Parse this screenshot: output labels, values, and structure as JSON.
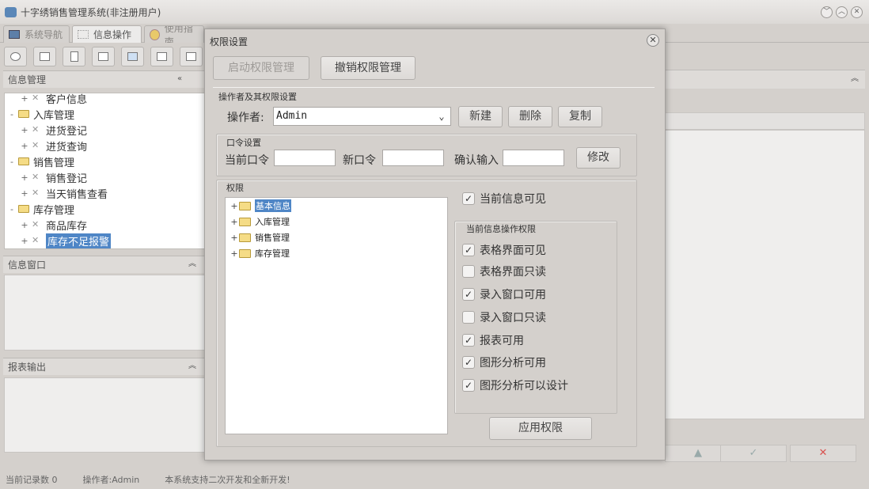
{
  "app": {
    "title": "十字绣销售管理系统(非注册用户)",
    "window_buttons": [
      "﹀",
      "︿",
      "✕"
    ]
  },
  "tabs": [
    {
      "label": "系统导航"
    },
    {
      "label": "信息操作"
    },
    {
      "label": "使用指南"
    }
  ],
  "left": {
    "info_mgmt": {
      "title": "信息管理",
      "collapse": "«"
    },
    "tree": [
      {
        "label": "客户信息",
        "level": 1,
        "exp": "+"
      },
      {
        "label": "入库管理",
        "level": 0,
        "exp": "-"
      },
      {
        "label": "进货登记",
        "level": 1,
        "exp": "+"
      },
      {
        "label": "进货查询",
        "level": 1,
        "exp": "+"
      },
      {
        "label": "销售管理",
        "level": 0,
        "exp": "-"
      },
      {
        "label": "销售登记",
        "level": 1,
        "exp": "+"
      },
      {
        "label": "当天销售查看",
        "level": 1,
        "exp": "+"
      },
      {
        "label": "库存管理",
        "level": 0,
        "exp": "-"
      },
      {
        "label": "商品库存",
        "level": 1,
        "exp": "+"
      },
      {
        "label": "库存不足报警",
        "level": 1,
        "exp": "+",
        "selected": true
      }
    ],
    "info_window": {
      "title": "信息窗口",
      "collapse": "︽"
    },
    "report": {
      "title": "报表输出",
      "collapse": "︽"
    }
  },
  "right": {
    "collapse": "︽",
    "nav_buttons": [
      "▲",
      "✓",
      "✕"
    ]
  },
  "status": {
    "records": "当前记录数 0",
    "operator": "操作者:Admin",
    "note": "本系统支持二次开发和全新开发!"
  },
  "dialog": {
    "title": "权限设置",
    "close": "✕",
    "start_btn": "启动权限管理",
    "revoke_btn": "撤销权限管理",
    "operator_section": "操作者及其权限设置",
    "operator_label": "操作者:",
    "operator_value": "Admin",
    "combo_arrow": "⌄",
    "new_btn": "新建",
    "delete_btn": "删除",
    "copy_btn": "复制",
    "password_section": "口令设置",
    "current_pw": "当前口令",
    "new_pw": "新口令",
    "confirm_pw": "确认输入",
    "modify_btn": "修改",
    "perm_section": "权限",
    "perm_tree": [
      {
        "label": "基本信息",
        "selected": true
      },
      {
        "label": "入库管理"
      },
      {
        "label": "销售管理"
      },
      {
        "label": "库存管理"
      }
    ],
    "visible_label": "当前信息可见",
    "visible_checked": true,
    "ops_section": "当前信息操作权限",
    "ops": [
      {
        "label": "表格界面可见",
        "checked": true
      },
      {
        "label": "表格界面只读",
        "checked": false
      },
      {
        "label": "录入窗口可用",
        "checked": true
      },
      {
        "label": "录入窗口只读",
        "checked": false
      },
      {
        "label": "报表可用",
        "checked": true
      },
      {
        "label": "图形分析可用",
        "checked": true
      },
      {
        "label": "图形分析可以设计",
        "checked": true
      }
    ],
    "apply_btn": "应用权限",
    "checkmark": "✓"
  }
}
